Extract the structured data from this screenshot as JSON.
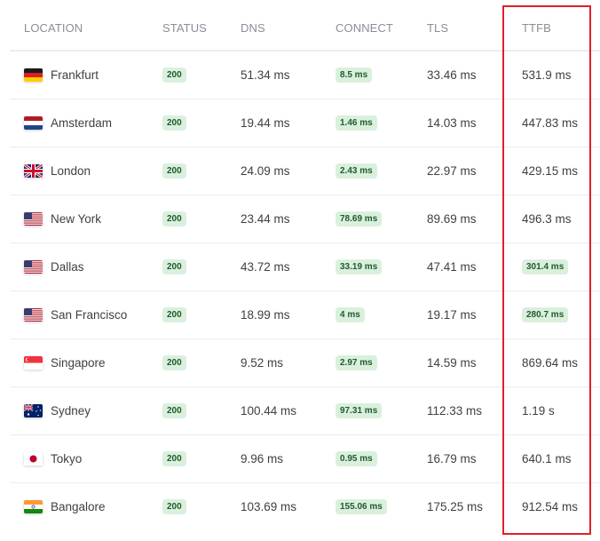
{
  "headers": {
    "location": "LOCATION",
    "status": "STATUS",
    "dns": "DNS",
    "connect": "CONNECT",
    "tls": "TLS",
    "ttfb": "TTFB"
  },
  "highlight": {
    "column": "ttfb",
    "color": "#e0202a"
  },
  "badge_colors": {
    "background": "#d9f0dd",
    "text": "#235a2c"
  },
  "rows": [
    {
      "flag": "germany-flag-icon",
      "location": "Frankfurt",
      "status": "200",
      "dns": "51.34 ms",
      "connect": "8.5 ms",
      "connect_badge": true,
      "tls": "33.46 ms",
      "ttfb": "531.9 ms",
      "ttfb_badge": false
    },
    {
      "flag": "netherlands-flag-icon",
      "location": "Amsterdam",
      "status": "200",
      "dns": "19.44 ms",
      "connect": "1.46 ms",
      "connect_badge": true,
      "tls": "14.03 ms",
      "ttfb": "447.83 ms",
      "ttfb_badge": false
    },
    {
      "flag": "uk-flag-icon",
      "location": "London",
      "status": "200",
      "dns": "24.09 ms",
      "connect": "2.43 ms",
      "connect_badge": true,
      "tls": "22.97 ms",
      "ttfb": "429.15 ms",
      "ttfb_badge": false
    },
    {
      "flag": "usa-flag-icon",
      "location": "New York",
      "status": "200",
      "dns": "23.44 ms",
      "connect": "78.69 ms",
      "connect_badge": true,
      "tls": "89.69 ms",
      "ttfb": "496.3 ms",
      "ttfb_badge": false
    },
    {
      "flag": "usa-flag-icon",
      "location": "Dallas",
      "status": "200",
      "dns": "43.72 ms",
      "connect": "33.19 ms",
      "connect_badge": true,
      "tls": "47.41 ms",
      "ttfb": "301.4 ms",
      "ttfb_badge": true
    },
    {
      "flag": "usa-flag-icon",
      "location": "San Francisco",
      "status": "200",
      "dns": "18.99 ms",
      "connect": "4 ms",
      "connect_badge": true,
      "tls": "19.17 ms",
      "ttfb": "280.7 ms",
      "ttfb_badge": true
    },
    {
      "flag": "singapore-flag-icon",
      "location": "Singapore",
      "status": "200",
      "dns": "9.52 ms",
      "connect": "2.97 ms",
      "connect_badge": true,
      "tls": "14.59 ms",
      "ttfb": "869.64 ms",
      "ttfb_badge": false
    },
    {
      "flag": "australia-flag-icon",
      "location": "Sydney",
      "status": "200",
      "dns": "100.44 ms",
      "connect": "97.31 ms",
      "connect_badge": true,
      "tls": "112.33 ms",
      "ttfb": "1.19 s",
      "ttfb_badge": false
    },
    {
      "flag": "japan-flag-icon",
      "location": "Tokyo",
      "status": "200",
      "dns": "9.96 ms",
      "connect": "0.95 ms",
      "connect_badge": true,
      "tls": "16.79 ms",
      "ttfb": "640.1 ms",
      "ttfb_badge": false
    },
    {
      "flag": "india-flag-icon",
      "location": "Bangalore",
      "status": "200",
      "dns": "103.69 ms",
      "connect": "155.06 ms",
      "connect_badge": true,
      "tls": "175.25 ms",
      "ttfb": "912.54 ms",
      "ttfb_badge": false
    }
  ]
}
